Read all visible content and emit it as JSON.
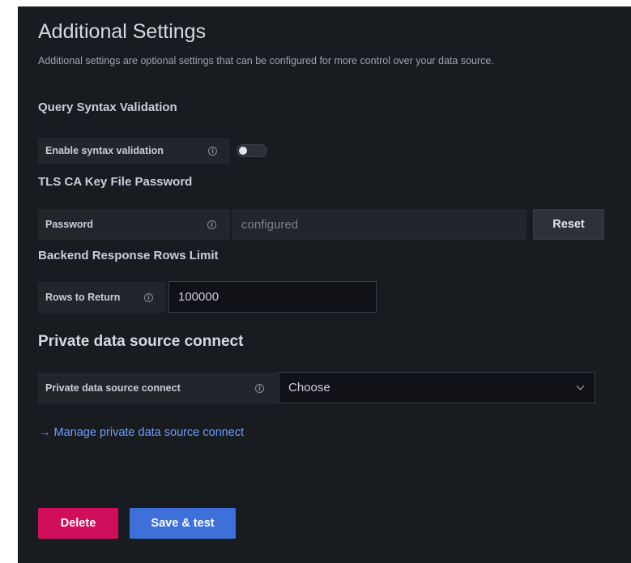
{
  "header": {
    "title": "Additional Settings",
    "description": "Additional settings are optional settings that can be configured for more control over your data source."
  },
  "query_syntax": {
    "section_title": "Query Syntax Validation",
    "label": "Enable syntax validation",
    "enabled": false
  },
  "tls": {
    "section_title": "TLS CA Key File Password",
    "label": "Password",
    "value": "configured",
    "reset_label": "Reset"
  },
  "rows_limit": {
    "section_title": "Backend Response Rows Limit",
    "label": "Rows to Return",
    "value": "100000"
  },
  "pdc": {
    "section_title": "Private data source connect",
    "label": "Private data source connect",
    "select_value": "Choose",
    "manage_link": "→ Manage private data source connect"
  },
  "actions": {
    "delete_label": "Delete",
    "save_label": "Save & test"
  },
  "icons": {
    "info": "info-circle-icon",
    "chevron": "chevron-down-icon"
  },
  "colors": {
    "background": "#181b1f",
    "danger": "#d10e5c",
    "primary": "#3d71d9",
    "link": "#6e9fff"
  }
}
